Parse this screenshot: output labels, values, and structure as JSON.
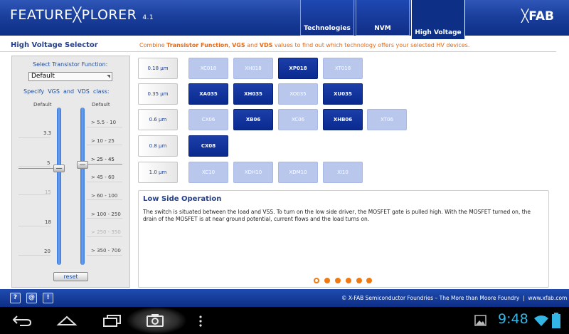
{
  "header": {
    "app_title": "FEATURE╳PLORER",
    "version": "4.1",
    "brand": "╳FAB",
    "tabs": [
      {
        "label": "Technologies"
      },
      {
        "label": "NVM"
      },
      {
        "label": "High Voltage"
      }
    ],
    "active_tab": "High Voltage"
  },
  "section": {
    "title": "High Voltage Selector",
    "desc_pre": "Combine ",
    "desc_b1": "Transistor Function",
    "desc_sep1": ", ",
    "desc_b2": "VGS",
    "desc_sep2": " and ",
    "desc_b3": "VDS",
    "desc_post": " values to find out which technology offers your selected HV devices."
  },
  "left_panel": {
    "select_label": "Select Transistor Function:",
    "select_value": "Default",
    "class_label": "Specify  VGS  and  VDS  class:",
    "vgs_default": "Default",
    "vds_default": "Default",
    "vgs_ticks": [
      "3.3",
      "5",
      "15",
      "18",
      "20"
    ],
    "vds_ticks": [
      "> 5.5 - 10",
      "> 10 - 25",
      "> 25 - 45",
      "> 45 - 60",
      "> 60 - 100",
      "> 100 - 250",
      "> 250 - 350",
      "> 350 - 700"
    ],
    "reset_label": "reset"
  },
  "grid": {
    "rows": [
      {
        "node": "0.18 µm",
        "techs": [
          {
            "name": "XC018",
            "active": false
          },
          {
            "name": "XH018",
            "active": false
          },
          {
            "name": "XP018",
            "active": true
          },
          {
            "name": "XT018",
            "active": false
          }
        ]
      },
      {
        "node": "0.35 µm",
        "techs": [
          {
            "name": "XA035",
            "active": true
          },
          {
            "name": "XH035",
            "active": true
          },
          {
            "name": "XO035",
            "active": false
          },
          {
            "name": "XU035",
            "active": true
          }
        ]
      },
      {
        "node": "0.6 µm",
        "techs": [
          {
            "name": "CX06",
            "active": false
          },
          {
            "name": "XB06",
            "active": true
          },
          {
            "name": "XC06",
            "active": false
          },
          {
            "name": "XHB06",
            "active": true
          },
          {
            "name": "XT06",
            "active": false
          }
        ]
      },
      {
        "node": "0.8 µm",
        "techs": [
          {
            "name": "CX08",
            "active": true
          }
        ]
      },
      {
        "node": "1.0 µm",
        "techs": [
          {
            "name": "XC10",
            "active": false
          },
          {
            "name": "XDH10",
            "active": false
          },
          {
            "name": "XDM10",
            "active": false
          },
          {
            "name": "XI10",
            "active": false
          }
        ]
      }
    ]
  },
  "description": {
    "title": "Low Side Operation",
    "body": "The switch is situated between the load and VSS. To turn on the low side driver, the MOSFET gate is pulled high. With the MOSFET turned on, the drain of the MOSFET is at near ground potential, current flows and the load turns on.",
    "page_count": 6,
    "current_page": 1
  },
  "footer": {
    "buttons": [
      "?",
      "@",
      "!"
    ],
    "copyright": "© X-FAB Semiconductor Foundries – The More than Moore Foundry  |  www.xfab.com"
  },
  "system": {
    "time": "9:48",
    "nav_icons": [
      "back-icon",
      "home-icon",
      "recent-apps-icon",
      "camera-icon",
      "overflow-menu-icon"
    ],
    "status_icons": [
      "gallery-icon",
      "wifi-icon",
      "battery-icon"
    ]
  },
  "colors": {
    "header_blue": "#1a3f9c",
    "active_tech": "#0a2a8f",
    "inactive_tech": "#b9c7ed",
    "accent_orange": "#e46a17",
    "clock_blue": "#33b5e5"
  }
}
